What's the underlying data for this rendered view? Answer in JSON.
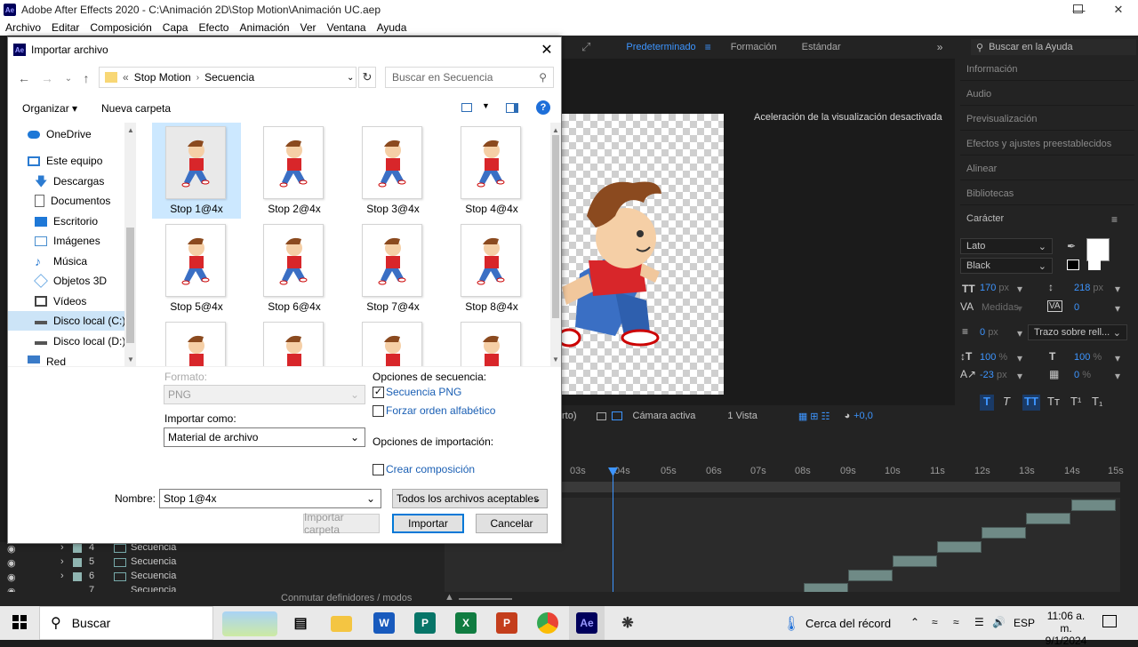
{
  "window": {
    "title": "Adobe After Effects 2020 - C:\\Animación 2D\\Stop Motion\\Animación UC.aep",
    "app_icon": "Ae"
  },
  "menu": [
    "Archivo",
    "Editar",
    "Composición",
    "Capa",
    "Efecto",
    "Animación",
    "Ver",
    "Ventana",
    "Ayuda"
  ],
  "workspaces": {
    "active": "Predeterminado",
    "items": [
      "Formación",
      "Estándar"
    ]
  },
  "help_search": "Buscar en la Ayuda",
  "comp_hint": "Aceleración de la visualización desactivada",
  "comp_footer": {
    "resolution": "rto)",
    "camera": "Cámara activa",
    "views": "1 Vista",
    "offset": "+0,0"
  },
  "right_panels": [
    "Información",
    "Audio",
    "Previsualización",
    "Efectos y ajustes preestablecidos",
    "Alinear",
    "Bibliotecas",
    "Carácter"
  ],
  "character": {
    "font": "Lato",
    "style": "Black",
    "size": "170",
    "size_unit": "px",
    "leading": "218",
    "leading_unit": "px",
    "kerning": "Medidas",
    "tracking": "0",
    "stroke": "0",
    "stroke_unit": "px",
    "stroke_mode": "Trazo sobre rell...",
    "vscale": "100",
    "hscale": "100",
    "pct": "%",
    "baseline": "-23",
    "baseline_unit": "px",
    "tsume": "0",
    "tsume_unit": "%",
    "styles": [
      "T",
      "T",
      "TT",
      "Tт",
      "T¹",
      "T₁"
    ]
  },
  "timeline": {
    "ticks": [
      "03s",
      "04s",
      "05s",
      "06s",
      "07s",
      "08s",
      "09s",
      "10s",
      "11s",
      "12s",
      "13s",
      "14s",
      "15s"
    ],
    "footer": "Conmutar definidores / modos"
  },
  "layers": [
    {
      "num": "4",
      "name": "Secuencia"
    },
    {
      "num": "5",
      "name": "Secuencia"
    },
    {
      "num": "6",
      "name": "Secuencia"
    },
    {
      "num": "7",
      "name": "Secuencia"
    }
  ],
  "dialog": {
    "title": "Importar archivo",
    "breadcrumb": [
      "«",
      "Stop Motion",
      "Secuencia"
    ],
    "search_placeholder": "Buscar en Secuencia",
    "organize": "Organizar ▾",
    "new_folder": "Nueva carpeta",
    "nav": [
      "OneDrive",
      "Este equipo",
      "Descargas",
      "Documentos",
      "Escritorio",
      "Imágenes",
      "Música",
      "Objetos 3D",
      "Vídeos",
      "Disco local (C:)",
      "Disco local (D:)",
      "Red"
    ],
    "files": [
      "Stop 1@4x",
      "Stop 2@4x",
      "Stop 3@4x",
      "Stop 4@4x",
      "Stop 5@4x",
      "Stop 6@4x",
      "Stop 7@4x",
      "Stop 8@4x"
    ],
    "format_label": "Formato:",
    "format_value": "PNG",
    "import_as_label": "Importar como:",
    "import_as_value": "Material de archivo",
    "seq_options_label": "Opciones de secuencia:",
    "seq_png": "Secuencia PNG",
    "force_alpha": "Forzar orden alfabético",
    "import_options_label": "Opciones de importación:",
    "create_comp": "Crear composición",
    "name_label": "Nombre:",
    "name_value": "Stop 1@4x",
    "filter": "Todos los archivos aceptables",
    "import_folder": "Importar carpeta",
    "import": "Importar",
    "cancel": "Cancelar"
  },
  "taskbar": {
    "search": "Buscar",
    "weather": "Cerca del récord",
    "lang": "ESP",
    "time": "11:06 a. m.",
    "date": "9/1/2024"
  }
}
